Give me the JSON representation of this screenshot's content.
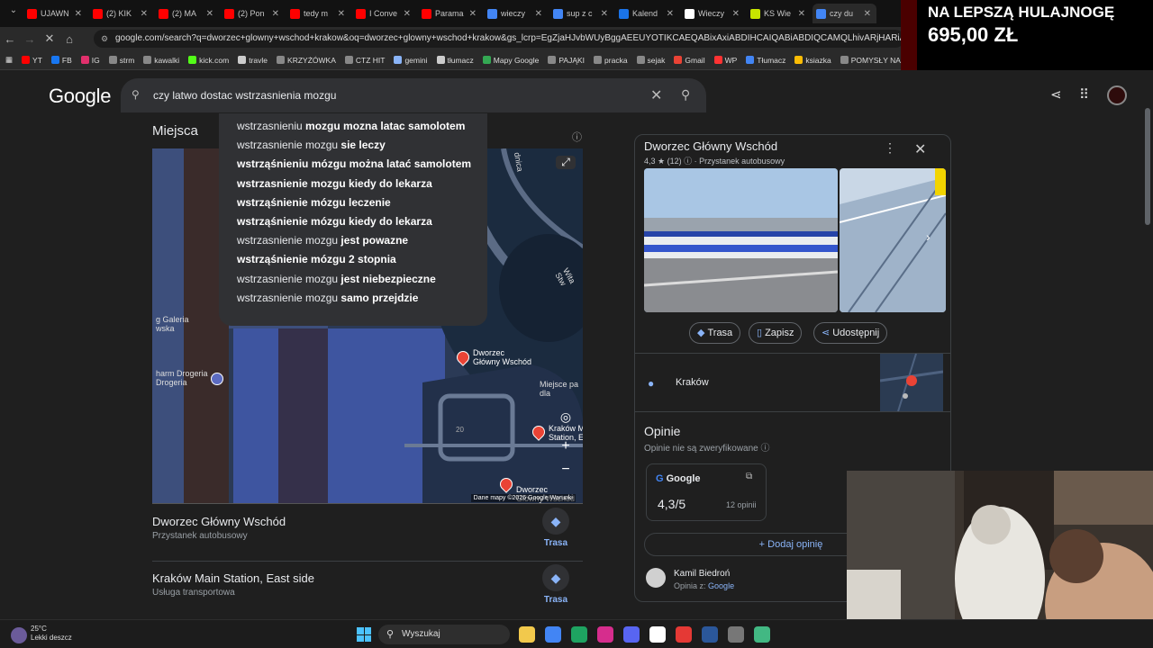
{
  "browser": {
    "tabs": [
      {
        "label": "UJAWN",
        "color": "#ff0000"
      },
      {
        "label": "(2) KIK",
        "color": "#ff0000"
      },
      {
        "label": "(2) MA",
        "color": "#ff0000"
      },
      {
        "label": "(2) Pon",
        "color": "#ff0000"
      },
      {
        "label": "tedy m",
        "color": "#ff0000"
      },
      {
        "label": "I Conve",
        "color": "#ff0000"
      },
      {
        "label": "Parama",
        "color": "#ff0000"
      },
      {
        "label": "wieczy",
        "color": "#4285f4"
      },
      {
        "label": "sup z c",
        "color": "#4285f4"
      },
      {
        "label": "Kalend",
        "color": "#1a73e8"
      },
      {
        "label": "Wieczy",
        "color": "#ffffff"
      },
      {
        "label": "KS Wie",
        "color": "#c8e600"
      },
      {
        "label": "czy du",
        "color": "#4285f4"
      }
    ],
    "url": "google.com/search?q=dworzec+glowny+wschod+krakow&oq=dworzec+glowny+wschod+krakow&gs_lcrp=EgZjaHJvbWUyBggAEEUYOTIKCAEQABixAxiABDIHCAIQABiABDIQCAMQLhivARjHARiABBIOBTIHCAQQ",
    "bookmarks": [
      {
        "label": "YT",
        "color": "#ff0000"
      },
      {
        "label": "FB",
        "color": "#1877f2"
      },
      {
        "label": "IG",
        "color": "#e1306c"
      },
      {
        "label": "strm",
        "color": "#888888"
      },
      {
        "label": "kawalki",
        "color": "#888888"
      },
      {
        "label": "kick.com",
        "color": "#53fc18"
      },
      {
        "label": "travle",
        "color": "#cccccc"
      },
      {
        "label": "KRZYŻÓWKA",
        "color": "#888888"
      },
      {
        "label": "CTZ HIT",
        "color": "#888888"
      },
      {
        "label": "gemini",
        "color": "#8ab4f8"
      },
      {
        "label": "tłumacz",
        "color": "#cccccc"
      },
      {
        "label": "Mapy Google",
        "color": "#34a853"
      },
      {
        "label": "PAJĄKI",
        "color": "#888888"
      },
      {
        "label": "pracka",
        "color": "#888888"
      },
      {
        "label": "sejak",
        "color": "#888888"
      },
      {
        "label": "Gmail",
        "color": "#ea4335"
      },
      {
        "label": "WP",
        "color": "#ff3333"
      },
      {
        "label": "Tłumacz",
        "color": "#4285f4"
      },
      {
        "label": "ksiazka",
        "color": "#fbbc05"
      },
      {
        "label": "POMYSŁY NA STRE...",
        "color": "#888888"
      }
    ]
  },
  "google": {
    "logo": "Google",
    "query": "czy latwo dostac wstrzasnienia mozgu",
    "suggestions": [
      {
        "normal": "wstrzasnieniu ",
        "bold": "mozgu mozna latac samolotem",
        "normal2": ""
      },
      {
        "normal": "wstrzasnienie mozgu ",
        "bold": "sie leczy",
        "normal2": ""
      },
      {
        "normal": "",
        "bold": "wstrząśnieniu mózgu można latać samolotem",
        "normal2": ""
      },
      {
        "normal": "",
        "bold": "wstrzasnienie mozgu kiedy do lekarza",
        "normal2": ""
      },
      {
        "normal": "",
        "bold": "wstrząśnienie mózgu leczenie",
        "normal2": ""
      },
      {
        "normal": "",
        "bold": "wstrząśnienie mózgu kiedy do lekarza",
        "normal2": ""
      },
      {
        "normal": "wstrzasnienie mozgu ",
        "bold": "jest powazne",
        "normal2": ""
      },
      {
        "normal": "",
        "bold": "wstrząśnienie mózgu 2 stopnia",
        "normal2": ""
      },
      {
        "normal": "wstrzasnienie mozgu ",
        "bold": "jest niebezpieczne",
        "normal2": ""
      },
      {
        "normal": "wstrzasnienie mozgu ",
        "bold": "samo przejdzie",
        "normal2": ""
      }
    ]
  },
  "places": {
    "heading": "Miejsca",
    "map_labels": {
      "galeria": "g Galeria\nwska",
      "drogeria": "harm Drogeria\nDrogeria",
      "dworzec1": "Dworzec\nGłówny Wschód",
      "dworzec2": "Dworzec\nGłówny Wschód",
      "krakow_station": "Kraków M\nStation, E",
      "miejsce": "Miejsce pa\ndla",
      "witast": "Wita Stw",
      "dnica": "dnica",
      "num20": "20",
      "copyright": "Dane mapy ©2026 Google   Warunki"
    },
    "results": [
      {
        "title": "Dworzec Główny Wschód",
        "subtitle": "Przystanek autobusowy",
        "route": "Trasa"
      },
      {
        "title": "Kraków Main Station, East side",
        "subtitle": "Usługa transportowa",
        "route": "Trasa"
      }
    ]
  },
  "knowledge_panel": {
    "title": "Dworzec Główny Wschód",
    "rating_line": "4,3 ★ (12)",
    "type": "Przystanek autobusowy",
    "actions": [
      "Trasa",
      "Zapisz",
      "Udostępnij"
    ],
    "location": "Kraków",
    "opinions_heading": "Opinie",
    "opinions_sub": "Opinie nie są zweryfikowane",
    "google_label": "Google",
    "score": "4,3/5",
    "count": "12 opinii",
    "add_review": "Dodaj opinię",
    "reviewer": "Kamil Biedroń",
    "review_from": "Opinia z:",
    "review_source": "Google"
  },
  "promo": {
    "line1": "NA LEPSZĄ HULAJNOGĘ",
    "line2": "695,00 ZŁ"
  },
  "taskbar": {
    "temp": "25°C",
    "weather": "Lekki deszcz",
    "search_label": "Wyszukaj",
    "apps": [
      "#f2c94c",
      "#4285f4",
      "#1ea361",
      "#d62d8d",
      "#5865f2",
      "#ffffff",
      "#e53935",
      "#2b579a",
      "#777777",
      "#42b883"
    ]
  },
  "colors": {
    "accent": "#8ab4f8",
    "bg": "#1f1f1f",
    "surface": "#303134"
  }
}
